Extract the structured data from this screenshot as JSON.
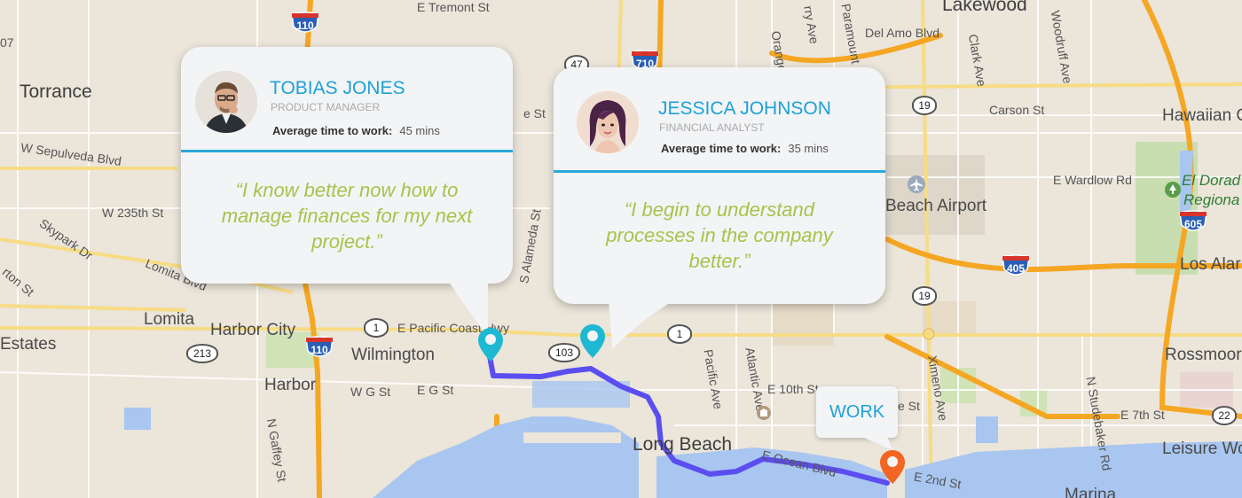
{
  "map_labels": {
    "torrance": "Torrance",
    "w_sepulveda": "W Sepulveda Blvd",
    "w_235th": "W 235th St",
    "skypark": "Skypark Dr",
    "lomita_blvd": "Lomita Blvd",
    "lomita": "Lomita",
    "harbor_city": "Harbor City",
    "estates": "Estates",
    "wilmington": "Wilmington",
    "harbor": "Harbor",
    "wg_st": "W G St",
    "eg_st": "E G St",
    "n_gaffey": "N Gaffey St",
    "e_pacific_coast": "E Pacific Coast Hwy",
    "s_alameda": "S Alameda St",
    "e_st": "e St",
    "e_tremont": "E Tremont St",
    "lakewood": "Lakewood",
    "del_amo": "Del Amo Blvd",
    "clark": "Clark Ave",
    "woodruff": "Woodruff Ave",
    "carson": "Carson St",
    "hawaiian": "Hawaiian G",
    "paramount": "Paramount",
    "orange": "Orange",
    "cherry": "rry Ave",
    "e_wardlow": "E Wardlow Rd",
    "el_dorado": "El Dorad",
    "regional": "Regiona",
    "beach_airport": "Beach Airport",
    "los_alam": "Los Alar",
    "rossmoor": "Rossmoor",
    "pacific_ave": "Pacific Ave",
    "atlantic_ave": "Atlantic Ave",
    "e_10th": "E 10th St",
    "ximeno": "Ximeno Ave",
    "n_studebaker": "N Studebaker Rd",
    "e_7th": "E 7th St",
    "long_beach": "Long Beach",
    "e_ocean": "E Ocean Blvd",
    "e_2nd": "E 2nd St",
    "leisure": "Leisure Worl",
    "marina": "Marina",
    "ton_st": "rton St",
    "n_ave": "Ave",
    "o7": "07",
    "e_st2": "e St"
  },
  "shields": {
    "i110_top": "110",
    "i110_bottom": "110",
    "i710": "710",
    "i405": "405",
    "i605": "605",
    "sr47": "47",
    "sr1_left": "1",
    "sr1_right": "1",
    "sr103": "103",
    "sr213": "213",
    "sr19_top": "19",
    "sr19_bottom": "19",
    "sr22": "22"
  },
  "cards": [
    {
      "name": "TOBIAS JONES",
      "role": "PRODUCT MANAGER",
      "avg_label": "Average time to work:",
      "avg_value": "45 mins",
      "quote": "“I know better now how to manage finances for my next project.”"
    },
    {
      "name": "JESSICA JOHNSON",
      "role": "FINANCIAL ANALYST",
      "avg_label": "Average time to work:",
      "avg_value": "35 mins",
      "quote": "“I begin to understand processes in the company better.”"
    }
  ],
  "work_label": "WORK",
  "icons": {
    "pin_home_1": "map-pin-icon",
    "pin_home_2": "map-pin-icon",
    "pin_work": "map-pin-icon",
    "airport": "airplane-icon",
    "park": "tree-icon",
    "landmark": "landmark-icon"
  },
  "colors": {
    "route": "#5b4ef0",
    "pin_home": "#1fb8d2",
    "pin_work": "#f26522",
    "accent_name": "#1ea1d6",
    "quote": "#a9c24a",
    "divider": "#2aa9d8",
    "freeway": "#f5a623"
  }
}
